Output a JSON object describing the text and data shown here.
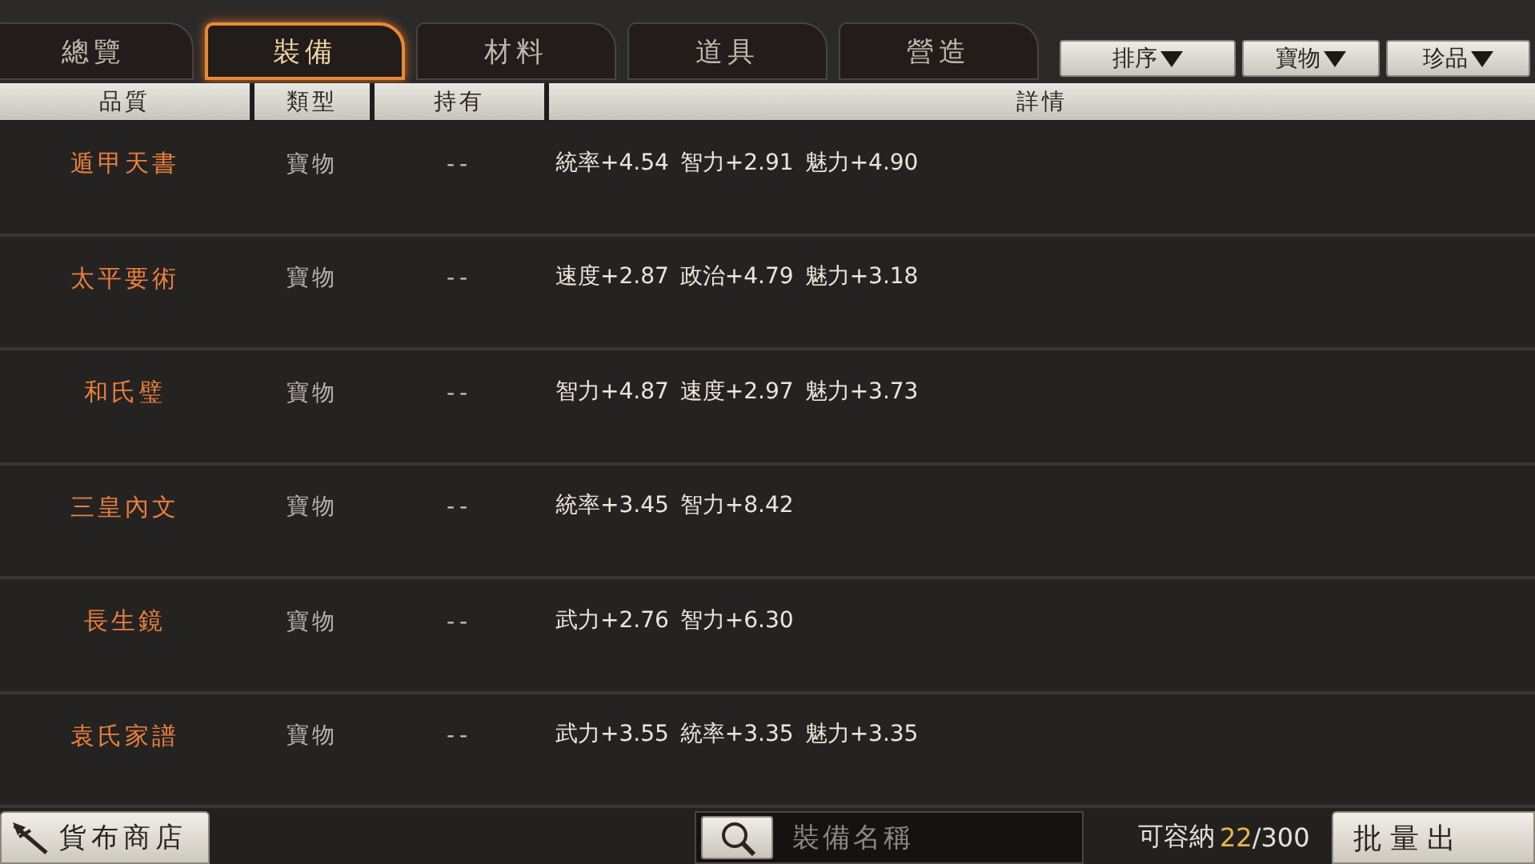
{
  "tabs": [
    {
      "label": "總覽",
      "selected": false
    },
    {
      "label": "裝備",
      "selected": true
    },
    {
      "label": "材料",
      "selected": false
    },
    {
      "label": "道具",
      "selected": false
    },
    {
      "label": "營造",
      "selected": false
    }
  ],
  "filters": [
    {
      "label": "排序"
    },
    {
      "label": "寶物"
    },
    {
      "label": "珍品"
    }
  ],
  "table": {
    "columns": [
      "品質",
      "類型",
      "持有",
      "詳情"
    ],
    "rows": [
      {
        "name": "遁甲天書",
        "type": "寶物",
        "owned": "--",
        "stats": [
          "統率+4.54",
          "智力+2.91",
          "魅力+4.90"
        ]
      },
      {
        "name": "太平要術",
        "type": "寶物",
        "owned": "--",
        "stats": [
          "速度+2.87",
          "政治+4.79",
          "魅力+3.18"
        ]
      },
      {
        "name": "和氏璧",
        "type": "寶物",
        "owned": "--",
        "stats": [
          "智力+4.87",
          "速度+2.97",
          "魅力+3.73"
        ]
      },
      {
        "name": "三皇內文",
        "type": "寶物",
        "owned": "--",
        "stats": [
          "統率+3.45",
          "智力+8.42"
        ]
      },
      {
        "name": "長生鏡",
        "type": "寶物",
        "owned": "--",
        "stats": [
          "武力+2.76",
          "智力+6.30"
        ]
      },
      {
        "name": "袁氏家譜",
        "type": "寶物",
        "owned": "--",
        "stats": [
          "武力+3.55",
          "統率+3.35",
          "魅力+3.35"
        ]
      }
    ]
  },
  "bottom_bar": {
    "shop_button": "貨布商店",
    "search": {
      "placeholder": "裝備名稱"
    },
    "capacity": {
      "label": "可容納",
      "count": "22",
      "max": "/300"
    },
    "batch_button": "批量出"
  }
}
